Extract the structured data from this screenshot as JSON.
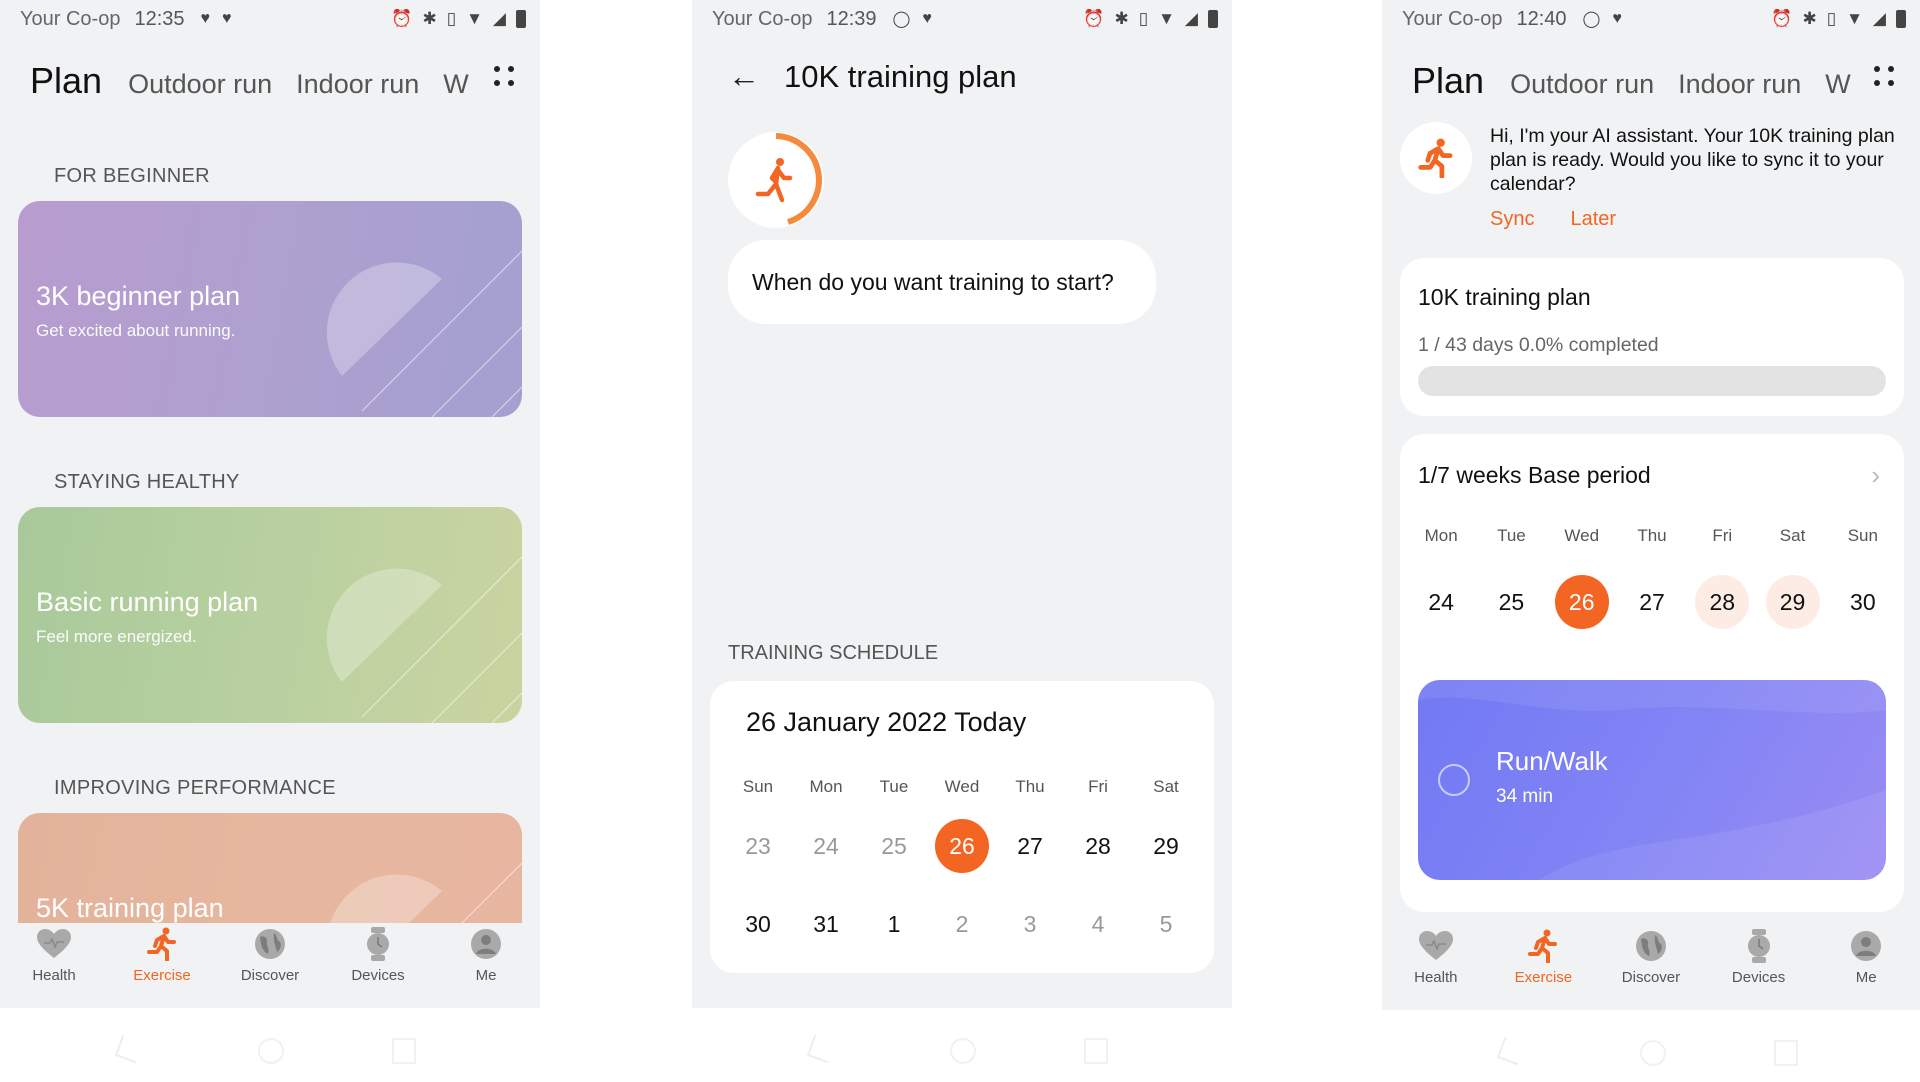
{
  "brand_color": "#f26522",
  "panels": [
    {
      "status": {
        "carrier": "Your Co-op",
        "time": "12:35"
      },
      "tabs": {
        "active": "Plan",
        "items": [
          "Outdoor run",
          "Indoor run",
          "W"
        ]
      },
      "sections": [
        {
          "label": "FOR BEGINNER",
          "card": {
            "title": "3K beginner plan",
            "subtitle": "Get excited about running."
          }
        },
        {
          "label": "STAYING HEALTHY",
          "card": {
            "title": "Basic running plan",
            "subtitle": "Feel more energized."
          }
        },
        {
          "label": "IMPROVING PERFORMANCE",
          "card": {
            "title": "5K training plan",
            "subtitle": ""
          }
        }
      ]
    },
    {
      "status": {
        "carrier": "Your Co-op",
        "time": "12:39"
      },
      "header": {
        "title": "10K training plan"
      },
      "question": "When do you want training to start?",
      "schedule_label": "TRAINING SCHEDULE",
      "calendar": {
        "title": "26 January 2022 Today",
        "weekdays": [
          "Sun",
          "Mon",
          "Tue",
          "Wed",
          "Thu",
          "Fri",
          "Sat"
        ],
        "weeks": [
          [
            {
              "d": "23",
              "s": "muted"
            },
            {
              "d": "24",
              "s": "muted"
            },
            {
              "d": "25",
              "s": "muted"
            },
            {
              "d": "26",
              "s": "today"
            },
            {
              "d": "27",
              "s": "dark"
            },
            {
              "d": "28",
              "s": "dark"
            },
            {
              "d": "29",
              "s": "dark"
            }
          ],
          [
            {
              "d": "30",
              "s": "dark"
            },
            {
              "d": "31",
              "s": "dark"
            },
            {
              "d": "1",
              "s": "dark"
            },
            {
              "d": "2",
              "s": "muted"
            },
            {
              "d": "3",
              "s": "muted"
            },
            {
              "d": "4",
              "s": "muted"
            },
            {
              "d": "5",
              "s": "muted"
            }
          ]
        ]
      }
    },
    {
      "status": {
        "carrier": "Your Co-op",
        "time": "12:40"
      },
      "tabs": {
        "active": "Plan",
        "items": [
          "Outdoor run",
          "Indoor run",
          "W"
        ]
      },
      "assistant": {
        "message": "Hi, I'm your AI assistant. Your 10K training plan plan is ready. Would you like to sync it to your calendar?",
        "sync_label": "Sync",
        "later_label": "Later"
      },
      "progress": {
        "title": "10K training plan",
        "summary": "1 / 43 days 0.0% completed",
        "percent": 0.0
      },
      "week": {
        "title": "1/7 weeks Base period",
        "weekdays": [
          "Mon",
          "Tue",
          "Wed",
          "Thu",
          "Fri",
          "Sat",
          "Sun"
        ],
        "days": [
          {
            "d": "24",
            "s": "dark"
          },
          {
            "d": "25",
            "s": "dark"
          },
          {
            "d": "26",
            "s": "today"
          },
          {
            "d": "27",
            "s": "dark"
          },
          {
            "d": "28",
            "s": "upcoming"
          },
          {
            "d": "29",
            "s": "upcoming"
          },
          {
            "d": "30",
            "s": "dark"
          }
        ],
        "task": {
          "title": "Run/Walk",
          "duration": "34 min"
        }
      }
    }
  ],
  "bottom_nav": [
    {
      "label": "Health",
      "icon": "heart-icon",
      "active": false
    },
    {
      "label": "Exercise",
      "icon": "runner-icon",
      "active": true
    },
    {
      "label": "Discover",
      "icon": "globe-icon",
      "active": false
    },
    {
      "label": "Devices",
      "icon": "watch-icon",
      "active": false
    },
    {
      "label": "Me",
      "icon": "person-icon",
      "active": false
    }
  ]
}
